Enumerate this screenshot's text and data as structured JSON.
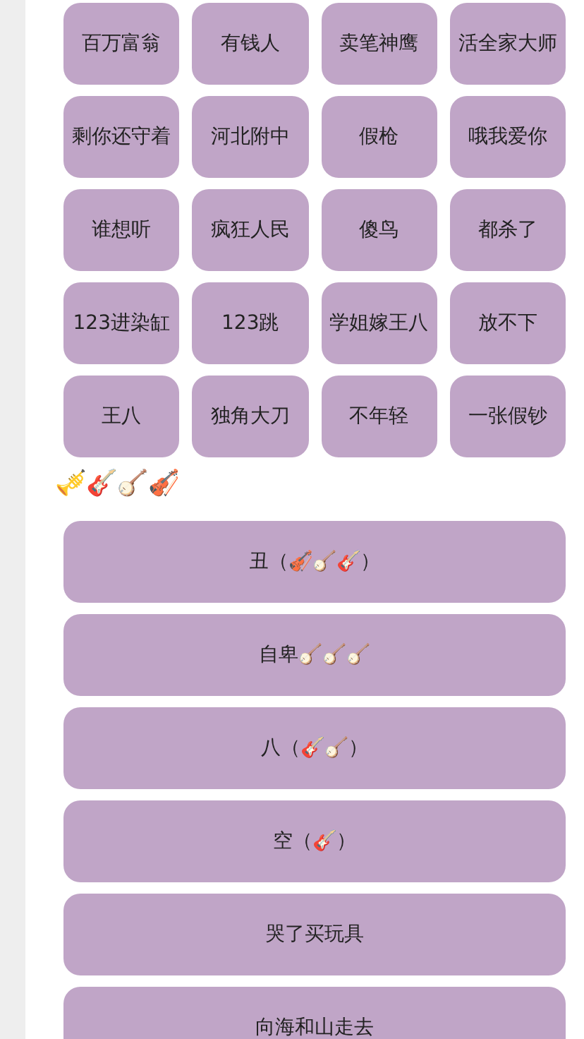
{
  "grid_buttons": [
    {
      "label": "百万富翁"
    },
    {
      "label": "有钱人"
    },
    {
      "label": "卖笔神鹰"
    },
    {
      "label": "活全家大师"
    },
    {
      "label": "剩你还守着"
    },
    {
      "label": "河北附中"
    },
    {
      "label": "假枪"
    },
    {
      "label": "哦我爱你"
    },
    {
      "label": "谁想听"
    },
    {
      "label": "疯狂人民"
    },
    {
      "label": "傻鸟"
    },
    {
      "label": "都杀了"
    },
    {
      "label": "123进染缸"
    },
    {
      "label": "123跳"
    },
    {
      "label": "学姐嫁王八"
    },
    {
      "label": "放不下"
    },
    {
      "label": "王八"
    },
    {
      "label": "独角大刀"
    },
    {
      "label": "不年轻"
    },
    {
      "label": "一张假钞"
    }
  ],
  "section_title": "🎺🎸🪕🎻",
  "list_buttons": [
    {
      "label": "丑（🎻🪕🎸）"
    },
    {
      "label": "自卑🪕🪕🪕"
    },
    {
      "label": "八（🎸🪕）"
    },
    {
      "label": "空（🎸）"
    },
    {
      "label": "哭了买玩具"
    },
    {
      "label": "向海和山走去"
    }
  ]
}
